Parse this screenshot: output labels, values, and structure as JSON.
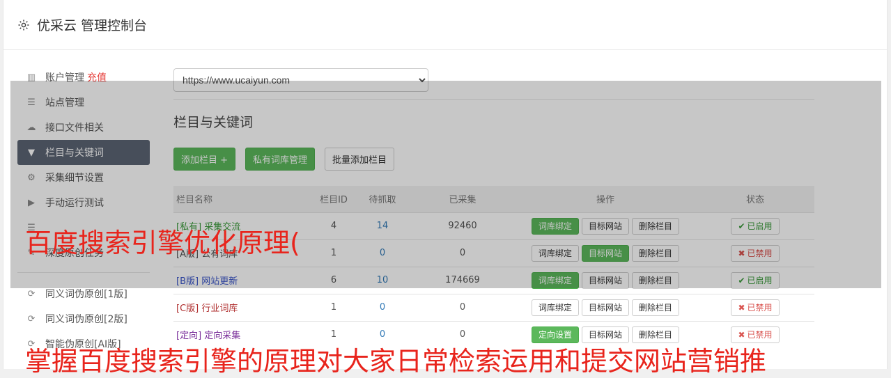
{
  "header": {
    "title": "优采云 管理控制台"
  },
  "sidebar": {
    "items": [
      {
        "label": "账户管理",
        "extra": "充值",
        "icon": "bar-chart-icon",
        "glyph": "▥"
      },
      {
        "label": "站点管理",
        "icon": "server-icon",
        "glyph": "☰"
      },
      {
        "label": "接口文件相关",
        "icon": "cloud-upload-icon",
        "glyph": "☁"
      },
      {
        "label": "栏目与关键词",
        "icon": "filter-icon",
        "glyph": "▼",
        "active": true
      },
      {
        "label": "采集细节设置",
        "icon": "cogs-icon",
        "glyph": "⚙"
      },
      {
        "label": "手动运行测试",
        "icon": "play-circle-icon",
        "glyph": "▶"
      },
      {
        "label": "",
        "icon": "list-icon",
        "glyph": "☰"
      },
      {
        "label": "深度原创任务",
        "icon": "edit-icon",
        "glyph": "✎"
      }
    ],
    "items2": [
      {
        "label": "同义词伪原创[1版]",
        "icon": "refresh-icon",
        "glyph": "⟳"
      },
      {
        "label": "同义词伪原创[2版]",
        "icon": "refresh-icon",
        "glyph": "⟳"
      },
      {
        "label": "智能伪原创[AI版]",
        "icon": "refresh-icon",
        "glyph": "⟳"
      }
    ]
  },
  "main": {
    "site_select": {
      "value": "https://www.ucaiyun.com"
    },
    "section_title": "栏目与关键词",
    "buttons": {
      "add": "添加栏目 +",
      "private": "私有词库管理",
      "batch": "批量添加栏目"
    },
    "table": {
      "headers": [
        "栏目名称",
        "栏目ID",
        "待抓取",
        "已采集",
        "操作",
        "状态"
      ],
      "rows": [
        {
          "tag": "[私有]",
          "name": "采集交流",
          "id": "4",
          "pending": "14",
          "collected": "92460",
          "ops": [
            "词库绑定",
            "目标网站",
            "删除栏目"
          ],
          "ops_green": [
            0
          ],
          "status": "已启用",
          "on": true,
          "tagclass": "tag-sys"
        },
        {
          "tag": "[A版]",
          "name": "公有词库",
          "id": "1",
          "pending": "0",
          "collected": "0",
          "ops": [
            "词库绑定",
            "目标网站",
            "删除栏目"
          ],
          "ops_green": [
            1
          ],
          "status": "已禁用",
          "on": false,
          "tagclass": "tag-a"
        },
        {
          "tag": "[B版]",
          "name": "网站更新",
          "id": "6",
          "pending": "10",
          "collected": "174669",
          "ops": [
            "词库绑定",
            "目标网站",
            "删除栏目"
          ],
          "ops_green": [
            0
          ],
          "status": "已启用",
          "on": true,
          "tagclass": "tag-b"
        },
        {
          "tag": "[C版]",
          "name": "行业词库",
          "id": "1",
          "pending": "0",
          "collected": "0",
          "ops": [
            "词库绑定",
            "目标网站",
            "删除栏目"
          ],
          "ops_green": [],
          "status": "已禁用",
          "on": false,
          "tagclass": "tag-c"
        },
        {
          "tag": "[定向]",
          "name": "定向采集",
          "id": "1",
          "pending": "0",
          "collected": "0",
          "ops": [
            "定向设置",
            "目标网站",
            "删除栏目"
          ],
          "ops_green": [
            0
          ],
          "status": "已禁用",
          "on": false,
          "tagclass": "tag-d"
        }
      ]
    }
  },
  "watermark": {
    "line1": "百度搜索引擎优化原理(",
    "line2": "掌握百度搜索引擎的原理对大家日常检索运用和提交网站营销推"
  },
  "colors": {
    "accent_green": "#5cb85c",
    "active_nav": "#5b6474",
    "watermark": "#e8241c"
  }
}
